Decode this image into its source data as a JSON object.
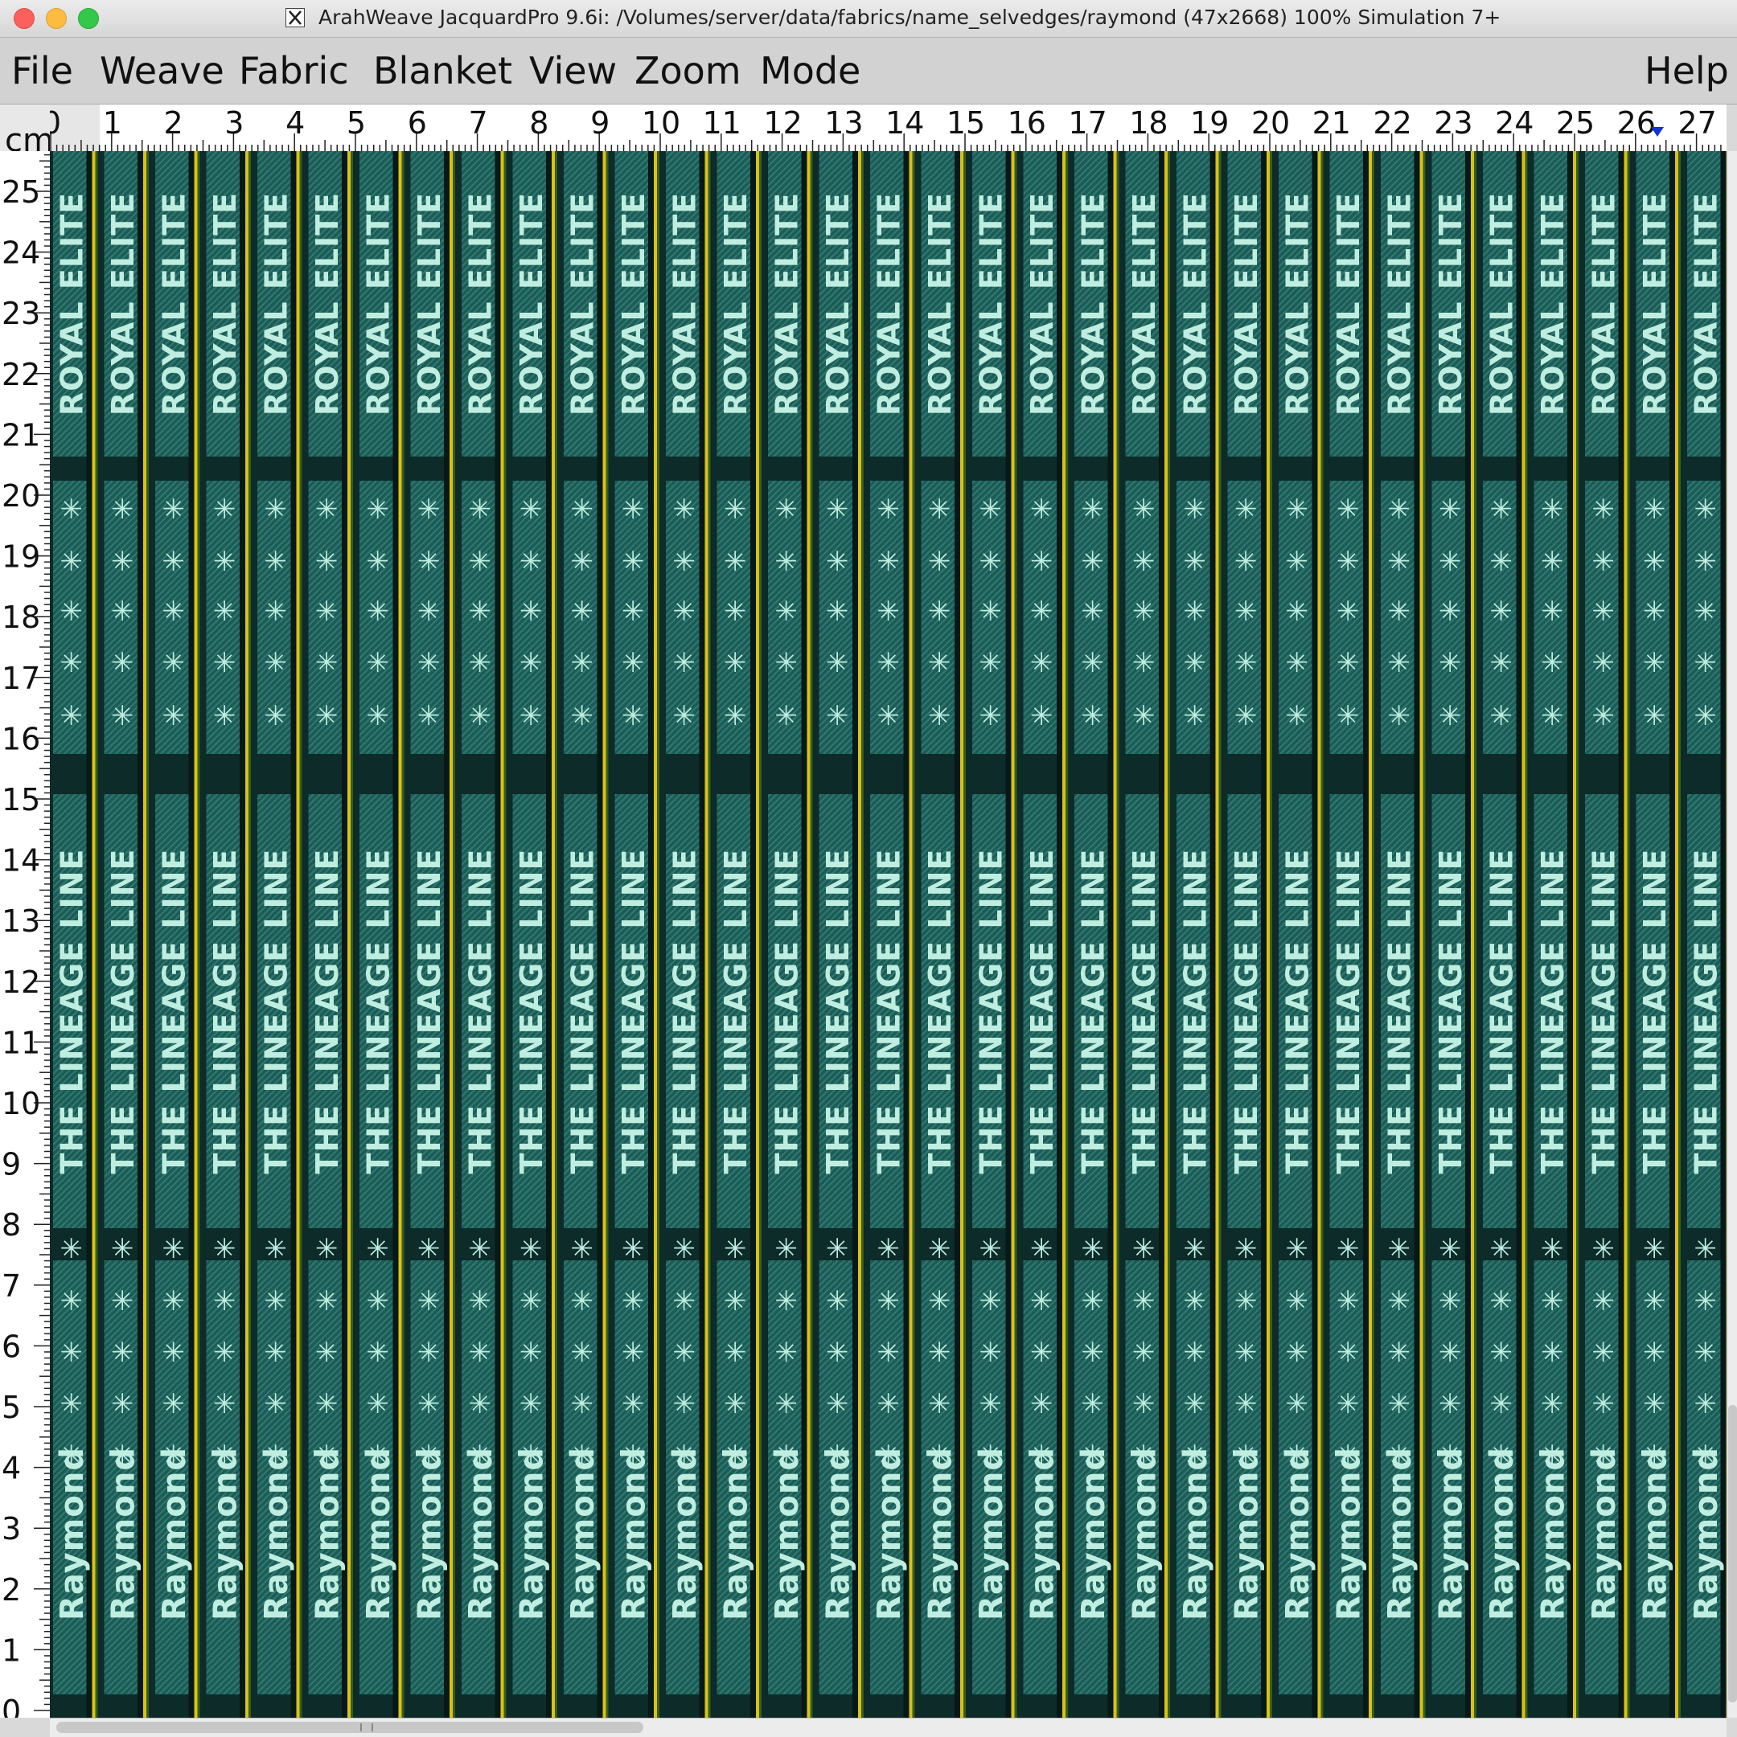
{
  "window": {
    "app_name": "ArahWeave JacquardPro 9.6i",
    "title": "ArahWeave JacquardPro 9.6i: /Volumes/server/data/fabrics/name_selvedges/raymond (47x2668) 100% Simulation 7+"
  },
  "menu": {
    "items": [
      "File",
      "Weave",
      "Fabric",
      "Blanket",
      "View",
      "Zoom",
      "Mode"
    ],
    "help": "Help"
  },
  "ruler": {
    "unit": "cm",
    "top_labels": [
      "0",
      "1",
      "2",
      "3",
      "4",
      "5",
      "6",
      "7",
      "8",
      "9",
      "10",
      "11",
      "12",
      "13",
      "14",
      "15",
      "16",
      "17",
      "18",
      "19",
      "20",
      "21",
      "22",
      "23",
      "24",
      "25",
      "26",
      "27"
    ],
    "left_labels": [
      "25",
      "24",
      "23",
      "22",
      "21",
      "20",
      "19",
      "18",
      "17",
      "16",
      "15",
      "14",
      "13",
      "12",
      "11",
      "10",
      "9",
      "8",
      "7",
      "6",
      "5",
      "4",
      "3",
      "2",
      "1",
      "0"
    ]
  },
  "fabric": {
    "strip_count": 33,
    "texts": {
      "top": "ROYAL ELITE",
      "middle": "THE LINEAGE LINE",
      "bottom": "Raymond",
      "motif": "✳"
    },
    "colors": {
      "ground": "#0c2b29",
      "band": "#1d5b56",
      "text": "#bfeee0",
      "stripe": "#d6c21a",
      "dark_line": "#061817"
    }
  }
}
